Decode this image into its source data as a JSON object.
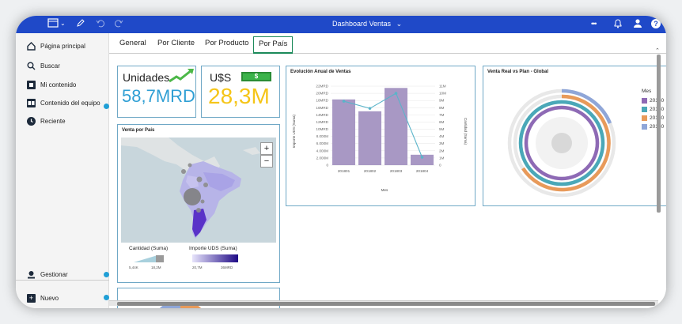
{
  "topbar": {
    "title": "Dashboard Ventas",
    "title_chevron": "⌄",
    "icons": [
      "grid-icon",
      "edit-icon",
      "undo-icon",
      "redo-icon",
      "more-icon",
      "bell-icon",
      "user-icon",
      "help-icon"
    ],
    "more_glyph": "•••",
    "help_glyph": "?"
  },
  "sidebar": {
    "items": [
      {
        "label": "Página principal",
        "icon": "home-icon",
        "glyph": "⌂"
      },
      {
        "label": "Buscar",
        "icon": "search-icon",
        "glyph": "⚲"
      },
      {
        "label": "Mi contenido",
        "icon": "folder-icon",
        "glyph": "▪"
      },
      {
        "label": "Contenido del equipo",
        "icon": "team-folder-icon",
        "glyph": "▪▪"
      },
      {
        "label": "Reciente",
        "icon": "clock-icon",
        "glyph": "◔"
      }
    ],
    "bottom": [
      {
        "label": "Gestionar",
        "icon": "manage-icon",
        "glyph": "✎"
      },
      {
        "label": "Nuevo",
        "icon": "plus-icon",
        "glyph": "+"
      }
    ]
  },
  "tabs": [
    {
      "label": "General"
    },
    {
      "label": "Por Cliente"
    },
    {
      "label": "Por Producto"
    },
    {
      "label": "Por País",
      "active": true
    }
  ],
  "kpis": [
    {
      "label": "Unidades",
      "value": "58,7MRD"
    },
    {
      "label": "U$S",
      "value": "28,3M",
      "badge": "$"
    }
  ],
  "map_card": {
    "title": "Venta por País",
    "zoom_in": "+",
    "zoom_out": "−",
    "legend": {
      "size_label": "Cantidad (Suma)",
      "size_min": "5,44K",
      "size_max": "18,2M",
      "color_label": "Importe UDS (Suma)",
      "color_min": "20,7M",
      "color_max": "36MRD"
    }
  },
  "chart_card": {
    "title": "Evolución Anual de Ventas",
    "ylabel": "Importe UDS (Suma)",
    "y2label": "Cantidad (Suma)",
    "xlabel": "Mes"
  },
  "donut_card": {
    "title": "Venta Real vs Plan - Global",
    "legend_title": "Mes",
    "legend": [
      {
        "label": "20180",
        "color": "#8e6ab5"
      },
      {
        "label": "20180",
        "color": "#4aa8b8"
      },
      {
        "label": "20180",
        "color": "#e89a5a"
      },
      {
        "label": "20180",
        "color": "#8fa6d8"
      }
    ]
  },
  "chart_data": {
    "type": "bar",
    "title": "Evolución Anual de Ventas",
    "categories": [
      "201801",
      "201802",
      "201803",
      "201804"
    ],
    "xlabel": "Mes",
    "ylabel": "Importe UDS (Suma)",
    "y_ticks": [
      "0",
      "2.000M",
      "4.000M",
      "6.000M",
      "8.000M",
      "10MRD",
      "12MRD",
      "14MRD",
      "16MRD",
      "18MRD",
      "20MRD",
      "22MRD"
    ],
    "y2_ticks": [
      "0",
      "1M",
      "2M",
      "3M",
      "4M",
      "5M",
      "6M",
      "7M",
      "8M",
      "9M",
      "10M",
      "11M"
    ],
    "ylim": [
      0,
      22
    ],
    "y2lim": [
      0,
      11
    ],
    "series": [
      {
        "name": "Importe UDS (Suma)",
        "kind": "bar",
        "values": [
          18.3,
          15.0,
          21.5,
          2.9
        ],
        "color": "#a898c4"
      },
      {
        "name": "Cantidad (Suma)",
        "kind": "line",
        "values": [
          8.9,
          7.9,
          10.0,
          1.1
        ],
        "color": "#5bb4c9"
      }
    ]
  }
}
